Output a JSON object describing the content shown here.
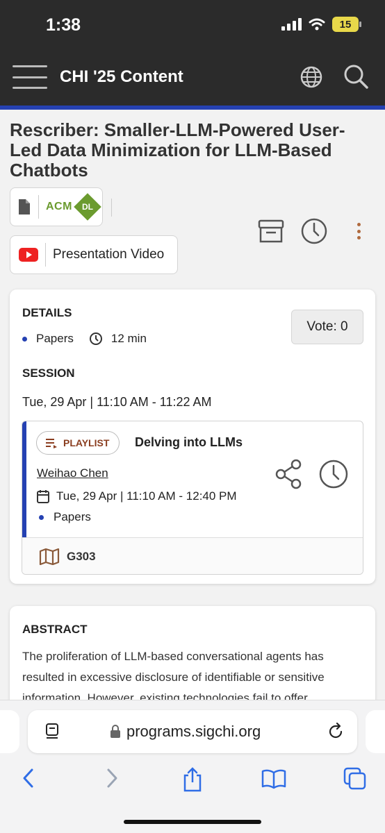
{
  "status_bar": {
    "time": "1:38",
    "battery": "15"
  },
  "app_header": {
    "title": "CHI '25 Content"
  },
  "paper": {
    "title": "Rescriber: Smaller-LLM-Powered User-Led Data Minimization for LLM-Based Chatbots",
    "acm_label": "ACM",
    "dl_label": "DL",
    "video_label": "Presentation Video"
  },
  "details": {
    "heading": "DETAILS",
    "type": "Papers",
    "duration": "12 min",
    "vote_label": "Vote: 0",
    "session_heading": "SESSION",
    "session_time": "Tue, 29 Apr | 11:10 AM - 11:22 AM"
  },
  "playlist": {
    "badge": "PLAYLIST",
    "title": "Delving into LLMs",
    "author": "Weihao Chen",
    "date": "Tue, 29 Apr | 11:10 AM - 12:40 PM",
    "type": "Papers",
    "room": "G303"
  },
  "abstract": {
    "heading": "ABSTRACT",
    "text": "The proliferation of LLM-based conversational agents has resulted in excessive disclosure of identifiable or sensitive information. However, existing technologies fail to offer"
  },
  "browser": {
    "url": "programs.sigchi.org"
  },
  "colors": {
    "accent": "#2541b2",
    "header_bg": "#2b2b2b",
    "brown": "#8a3d1f",
    "acm_green": "#6b9b2f"
  }
}
